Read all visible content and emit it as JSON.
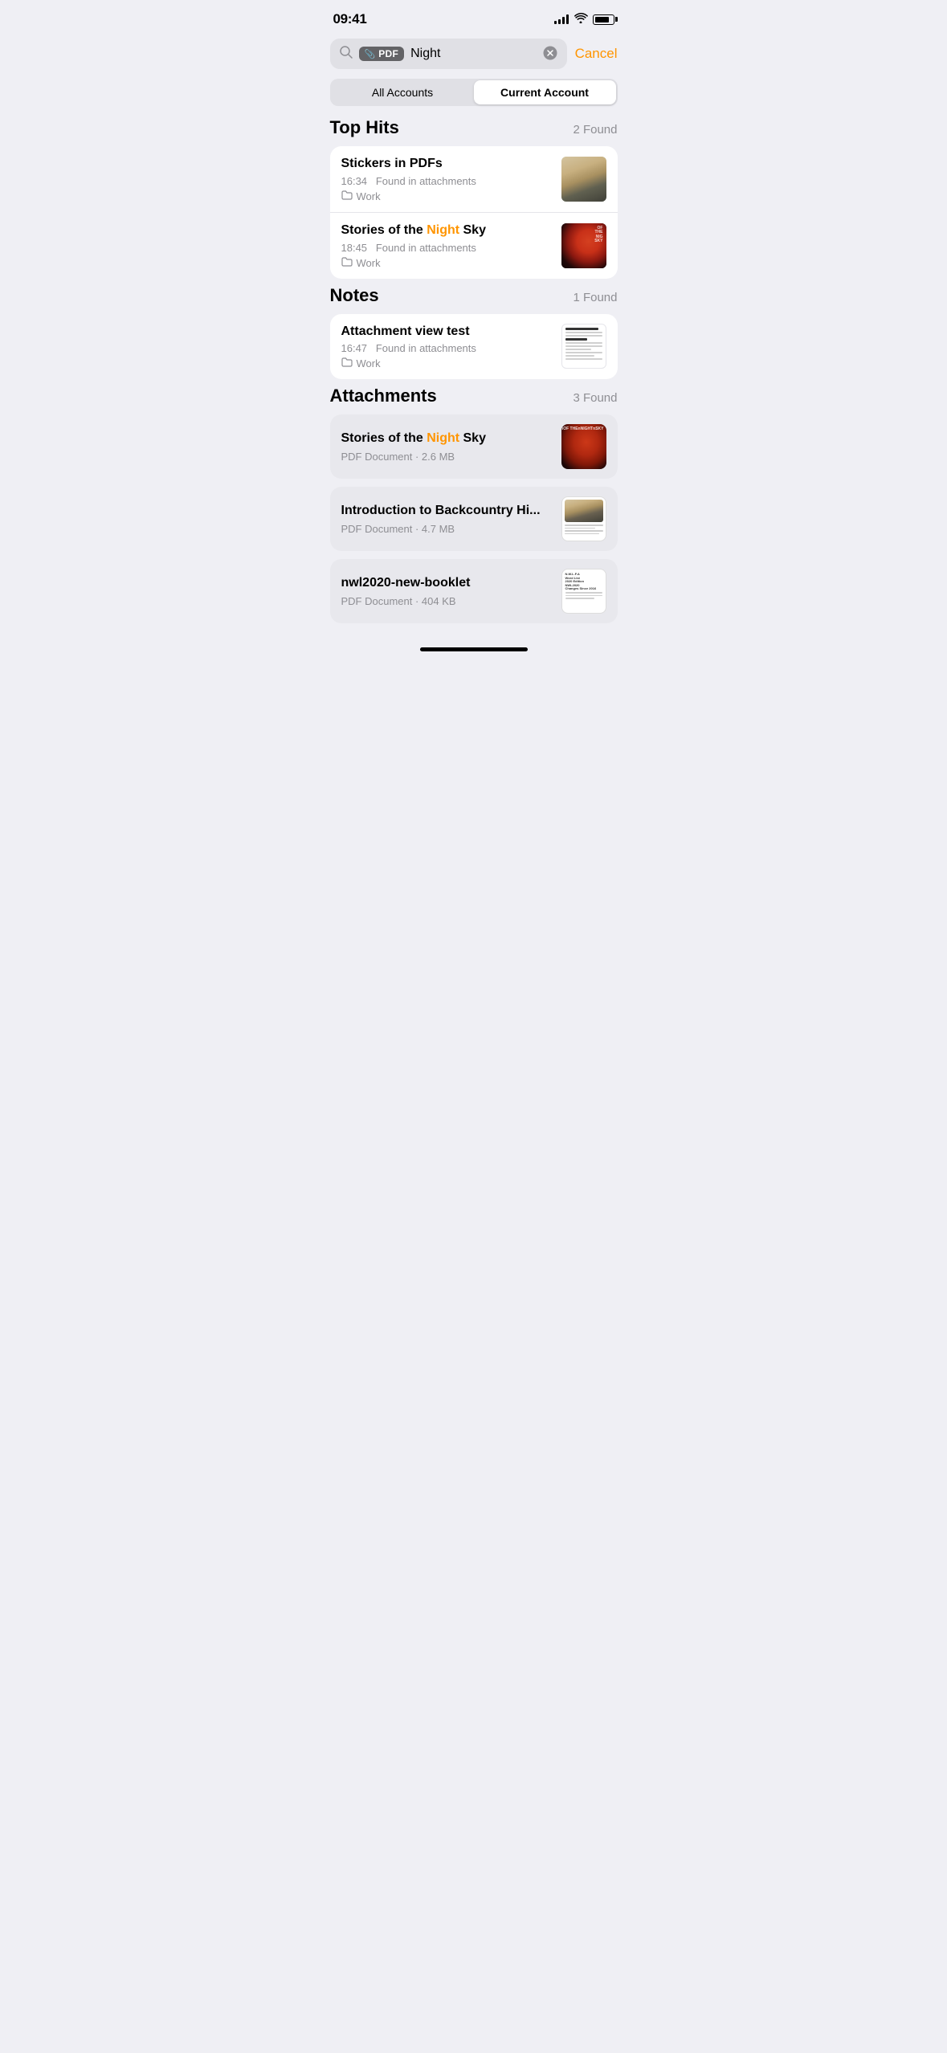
{
  "statusBar": {
    "time": "09:41",
    "signal": 4,
    "wifi": true,
    "battery": 85
  },
  "search": {
    "filterLabel": "PDF",
    "filterIcon": "paperclip",
    "query": "Night",
    "clearLabel": "×",
    "cancelLabel": "Cancel",
    "placeholder": "Search"
  },
  "segmented": {
    "options": [
      "All Accounts",
      "Current Account"
    ],
    "activeIndex": 1
  },
  "topHits": {
    "title": "Top Hits",
    "count": "2 Found",
    "items": [
      {
        "title": "Stickers in PDFs",
        "titleParts": [
          {
            "text": "Stickers in PDFs",
            "highlight": false
          }
        ],
        "time": "16:34",
        "meta": "Found in attachments",
        "folder": "Work",
        "thumbType": "landscape"
      },
      {
        "title": "Stories of the Night Sky",
        "titleParts": [
          {
            "text": "Stories of the ",
            "highlight": false
          },
          {
            "text": "Night",
            "highlight": true
          },
          {
            "text": " Sky",
            "highlight": false
          }
        ],
        "time": "18:45",
        "meta": "Found in attachments",
        "folder": "Work",
        "thumbType": "nightsky"
      }
    ]
  },
  "notes": {
    "title": "Notes",
    "count": "1 Found",
    "items": [
      {
        "title": "Attachment view test",
        "time": "16:47",
        "meta": "Found in attachments",
        "folder": "Work",
        "thumbType": "doc"
      }
    ]
  },
  "attachments": {
    "title": "Attachments",
    "count": "3 Found",
    "items": [
      {
        "title": "Stories of the Night Sky",
        "titleParts": [
          {
            "text": "Stories of the ",
            "highlight": false
          },
          {
            "text": "Night",
            "highlight": true
          },
          {
            "text": " Sky",
            "highlight": false
          }
        ],
        "fileType": "PDF Document",
        "fileSize": "2.6 MB",
        "thumbType": "nightsky-large"
      },
      {
        "title": "Introduction to Backcountry Hi...",
        "titleParts": [
          {
            "text": "Introduction to Backcountry Hi...",
            "highlight": false
          }
        ],
        "fileType": "PDF Document",
        "fileSize": "4.7 MB",
        "thumbType": "hike"
      },
      {
        "title": "nwl2020-new-booklet",
        "titleParts": [
          {
            "text": "nwl2020-new-booklet",
            "highlight": false
          }
        ],
        "fileType": "PDF Document",
        "fileSize": "404 KB",
        "thumbType": "booklet"
      }
    ]
  },
  "colors": {
    "highlight": "#ff9500",
    "secondaryText": "#8e8e93",
    "background": "#efeff4",
    "cardBg": "#ffffff",
    "attachmentBg": "#e8e8ed"
  }
}
